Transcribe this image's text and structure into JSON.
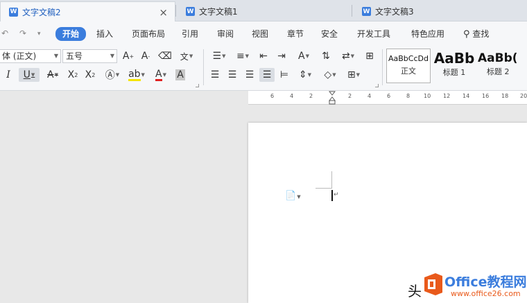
{
  "tabs": [
    {
      "label": "文字文稿2",
      "active": true,
      "closable": true
    },
    {
      "label": "文字文稿1",
      "active": false
    },
    {
      "label": "文字文稿3",
      "active": false
    }
  ],
  "menu": {
    "items": [
      "开始",
      "插入",
      "页面布局",
      "引用",
      "审阅",
      "视图",
      "章节",
      "安全",
      "开发工具",
      "特色应用"
    ],
    "active": "开始",
    "search_label": "查找"
  },
  "toolbar": {
    "font_name": "体 (正文)",
    "font_size": "五号",
    "pinyin_label": "文"
  },
  "styles": [
    {
      "sample": "AaBbCcDd",
      "label": "正文",
      "selected": true
    },
    {
      "sample": "AaBb",
      "label": "标题 1"
    },
    {
      "sample": "AaBb(",
      "label": "标题 2"
    }
  ],
  "ruler": {
    "left_numbers": [
      "6",
      "4",
      "2"
    ],
    "right_numbers": [
      "2",
      "4",
      "6",
      "8",
      "10",
      "12",
      "14",
      "16",
      "18",
      "20"
    ]
  },
  "watermark": {
    "brand": "Office教程网",
    "url": "www.office26.com",
    "prefix_text": "头"
  },
  "colors": {
    "accent": "#3b7ddd",
    "highlight": "#f5e400",
    "font_color": "#e02020",
    "office_logo": "#e95a1b"
  }
}
